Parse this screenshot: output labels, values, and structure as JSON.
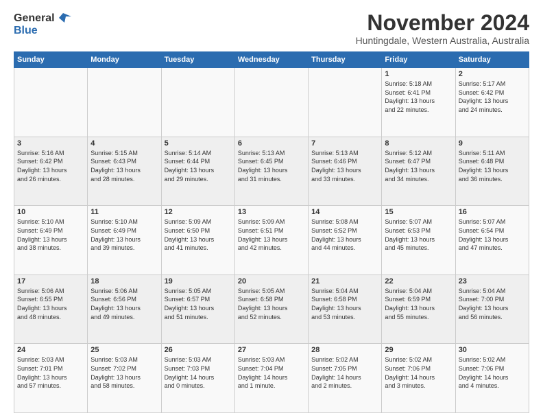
{
  "header": {
    "logo_general": "General",
    "logo_blue": "Blue",
    "title": "November 2024",
    "subtitle": "Huntingdale, Western Australia, Australia"
  },
  "calendar": {
    "days_of_week": [
      "Sunday",
      "Monday",
      "Tuesday",
      "Wednesday",
      "Thursday",
      "Friday",
      "Saturday"
    ],
    "weeks": [
      [
        {
          "day": "",
          "info": ""
        },
        {
          "day": "",
          "info": ""
        },
        {
          "day": "",
          "info": ""
        },
        {
          "day": "",
          "info": ""
        },
        {
          "day": "",
          "info": ""
        },
        {
          "day": "1",
          "info": "Sunrise: 5:18 AM\nSunset: 6:41 PM\nDaylight: 13 hours\nand 22 minutes."
        },
        {
          "day": "2",
          "info": "Sunrise: 5:17 AM\nSunset: 6:42 PM\nDaylight: 13 hours\nand 24 minutes."
        }
      ],
      [
        {
          "day": "3",
          "info": "Sunrise: 5:16 AM\nSunset: 6:42 PM\nDaylight: 13 hours\nand 26 minutes."
        },
        {
          "day": "4",
          "info": "Sunrise: 5:15 AM\nSunset: 6:43 PM\nDaylight: 13 hours\nand 28 minutes."
        },
        {
          "day": "5",
          "info": "Sunrise: 5:14 AM\nSunset: 6:44 PM\nDaylight: 13 hours\nand 29 minutes."
        },
        {
          "day": "6",
          "info": "Sunrise: 5:13 AM\nSunset: 6:45 PM\nDaylight: 13 hours\nand 31 minutes."
        },
        {
          "day": "7",
          "info": "Sunrise: 5:13 AM\nSunset: 6:46 PM\nDaylight: 13 hours\nand 33 minutes."
        },
        {
          "day": "8",
          "info": "Sunrise: 5:12 AM\nSunset: 6:47 PM\nDaylight: 13 hours\nand 34 minutes."
        },
        {
          "day": "9",
          "info": "Sunrise: 5:11 AM\nSunset: 6:48 PM\nDaylight: 13 hours\nand 36 minutes."
        }
      ],
      [
        {
          "day": "10",
          "info": "Sunrise: 5:10 AM\nSunset: 6:49 PM\nDaylight: 13 hours\nand 38 minutes."
        },
        {
          "day": "11",
          "info": "Sunrise: 5:10 AM\nSunset: 6:49 PM\nDaylight: 13 hours\nand 39 minutes."
        },
        {
          "day": "12",
          "info": "Sunrise: 5:09 AM\nSunset: 6:50 PM\nDaylight: 13 hours\nand 41 minutes."
        },
        {
          "day": "13",
          "info": "Sunrise: 5:09 AM\nSunset: 6:51 PM\nDaylight: 13 hours\nand 42 minutes."
        },
        {
          "day": "14",
          "info": "Sunrise: 5:08 AM\nSunset: 6:52 PM\nDaylight: 13 hours\nand 44 minutes."
        },
        {
          "day": "15",
          "info": "Sunrise: 5:07 AM\nSunset: 6:53 PM\nDaylight: 13 hours\nand 45 minutes."
        },
        {
          "day": "16",
          "info": "Sunrise: 5:07 AM\nSunset: 6:54 PM\nDaylight: 13 hours\nand 47 minutes."
        }
      ],
      [
        {
          "day": "17",
          "info": "Sunrise: 5:06 AM\nSunset: 6:55 PM\nDaylight: 13 hours\nand 48 minutes."
        },
        {
          "day": "18",
          "info": "Sunrise: 5:06 AM\nSunset: 6:56 PM\nDaylight: 13 hours\nand 49 minutes."
        },
        {
          "day": "19",
          "info": "Sunrise: 5:05 AM\nSunset: 6:57 PM\nDaylight: 13 hours\nand 51 minutes."
        },
        {
          "day": "20",
          "info": "Sunrise: 5:05 AM\nSunset: 6:58 PM\nDaylight: 13 hours\nand 52 minutes."
        },
        {
          "day": "21",
          "info": "Sunrise: 5:04 AM\nSunset: 6:58 PM\nDaylight: 13 hours\nand 53 minutes."
        },
        {
          "day": "22",
          "info": "Sunrise: 5:04 AM\nSunset: 6:59 PM\nDaylight: 13 hours\nand 55 minutes."
        },
        {
          "day": "23",
          "info": "Sunrise: 5:04 AM\nSunset: 7:00 PM\nDaylight: 13 hours\nand 56 minutes."
        }
      ],
      [
        {
          "day": "24",
          "info": "Sunrise: 5:03 AM\nSunset: 7:01 PM\nDaylight: 13 hours\nand 57 minutes."
        },
        {
          "day": "25",
          "info": "Sunrise: 5:03 AM\nSunset: 7:02 PM\nDaylight: 13 hours\nand 58 minutes."
        },
        {
          "day": "26",
          "info": "Sunrise: 5:03 AM\nSunset: 7:03 PM\nDaylight: 14 hours\nand 0 minutes."
        },
        {
          "day": "27",
          "info": "Sunrise: 5:03 AM\nSunset: 7:04 PM\nDaylight: 14 hours\nand 1 minute."
        },
        {
          "day": "28",
          "info": "Sunrise: 5:02 AM\nSunset: 7:05 PM\nDaylight: 14 hours\nand 2 minutes."
        },
        {
          "day": "29",
          "info": "Sunrise: 5:02 AM\nSunset: 7:06 PM\nDaylight: 14 hours\nand 3 minutes."
        },
        {
          "day": "30",
          "info": "Sunrise: 5:02 AM\nSunset: 7:06 PM\nDaylight: 14 hours\nand 4 minutes."
        }
      ]
    ]
  }
}
